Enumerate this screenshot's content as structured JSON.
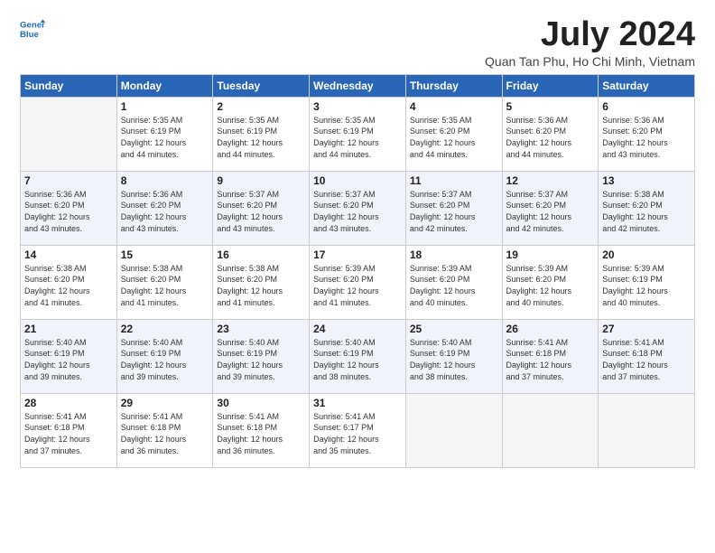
{
  "logo": {
    "line1": "General",
    "line2": "Blue"
  },
  "title": "July 2024",
  "subtitle": "Quan Tan Phu, Ho Chi Minh, Vietnam",
  "weekdays": [
    "Sunday",
    "Monday",
    "Tuesday",
    "Wednesday",
    "Thursday",
    "Friday",
    "Saturday"
  ],
  "weeks": [
    [
      {
        "day": "",
        "info": ""
      },
      {
        "day": "1",
        "info": "Sunrise: 5:35 AM\nSunset: 6:19 PM\nDaylight: 12 hours\nand 44 minutes."
      },
      {
        "day": "2",
        "info": "Sunrise: 5:35 AM\nSunset: 6:19 PM\nDaylight: 12 hours\nand 44 minutes."
      },
      {
        "day": "3",
        "info": "Sunrise: 5:35 AM\nSunset: 6:19 PM\nDaylight: 12 hours\nand 44 minutes."
      },
      {
        "day": "4",
        "info": "Sunrise: 5:35 AM\nSunset: 6:20 PM\nDaylight: 12 hours\nand 44 minutes."
      },
      {
        "day": "5",
        "info": "Sunrise: 5:36 AM\nSunset: 6:20 PM\nDaylight: 12 hours\nand 44 minutes."
      },
      {
        "day": "6",
        "info": "Sunrise: 5:36 AM\nSunset: 6:20 PM\nDaylight: 12 hours\nand 43 minutes."
      }
    ],
    [
      {
        "day": "7",
        "info": "Sunrise: 5:36 AM\nSunset: 6:20 PM\nDaylight: 12 hours\nand 43 minutes."
      },
      {
        "day": "8",
        "info": "Sunrise: 5:36 AM\nSunset: 6:20 PM\nDaylight: 12 hours\nand 43 minutes."
      },
      {
        "day": "9",
        "info": "Sunrise: 5:37 AM\nSunset: 6:20 PM\nDaylight: 12 hours\nand 43 minutes."
      },
      {
        "day": "10",
        "info": "Sunrise: 5:37 AM\nSunset: 6:20 PM\nDaylight: 12 hours\nand 43 minutes."
      },
      {
        "day": "11",
        "info": "Sunrise: 5:37 AM\nSunset: 6:20 PM\nDaylight: 12 hours\nand 42 minutes."
      },
      {
        "day": "12",
        "info": "Sunrise: 5:37 AM\nSunset: 6:20 PM\nDaylight: 12 hours\nand 42 minutes."
      },
      {
        "day": "13",
        "info": "Sunrise: 5:38 AM\nSunset: 6:20 PM\nDaylight: 12 hours\nand 42 minutes."
      }
    ],
    [
      {
        "day": "14",
        "info": "Sunrise: 5:38 AM\nSunset: 6:20 PM\nDaylight: 12 hours\nand 41 minutes."
      },
      {
        "day": "15",
        "info": "Sunrise: 5:38 AM\nSunset: 6:20 PM\nDaylight: 12 hours\nand 41 minutes."
      },
      {
        "day": "16",
        "info": "Sunrise: 5:38 AM\nSunset: 6:20 PM\nDaylight: 12 hours\nand 41 minutes."
      },
      {
        "day": "17",
        "info": "Sunrise: 5:39 AM\nSunset: 6:20 PM\nDaylight: 12 hours\nand 41 minutes."
      },
      {
        "day": "18",
        "info": "Sunrise: 5:39 AM\nSunset: 6:20 PM\nDaylight: 12 hours\nand 40 minutes."
      },
      {
        "day": "19",
        "info": "Sunrise: 5:39 AM\nSunset: 6:20 PM\nDaylight: 12 hours\nand 40 minutes."
      },
      {
        "day": "20",
        "info": "Sunrise: 5:39 AM\nSunset: 6:19 PM\nDaylight: 12 hours\nand 40 minutes."
      }
    ],
    [
      {
        "day": "21",
        "info": "Sunrise: 5:40 AM\nSunset: 6:19 PM\nDaylight: 12 hours\nand 39 minutes."
      },
      {
        "day": "22",
        "info": "Sunrise: 5:40 AM\nSunset: 6:19 PM\nDaylight: 12 hours\nand 39 minutes."
      },
      {
        "day": "23",
        "info": "Sunrise: 5:40 AM\nSunset: 6:19 PM\nDaylight: 12 hours\nand 39 minutes."
      },
      {
        "day": "24",
        "info": "Sunrise: 5:40 AM\nSunset: 6:19 PM\nDaylight: 12 hours\nand 38 minutes."
      },
      {
        "day": "25",
        "info": "Sunrise: 5:40 AM\nSunset: 6:19 PM\nDaylight: 12 hours\nand 38 minutes."
      },
      {
        "day": "26",
        "info": "Sunrise: 5:41 AM\nSunset: 6:18 PM\nDaylight: 12 hours\nand 37 minutes."
      },
      {
        "day": "27",
        "info": "Sunrise: 5:41 AM\nSunset: 6:18 PM\nDaylight: 12 hours\nand 37 minutes."
      }
    ],
    [
      {
        "day": "28",
        "info": "Sunrise: 5:41 AM\nSunset: 6:18 PM\nDaylight: 12 hours\nand 37 minutes."
      },
      {
        "day": "29",
        "info": "Sunrise: 5:41 AM\nSunset: 6:18 PM\nDaylight: 12 hours\nand 36 minutes."
      },
      {
        "day": "30",
        "info": "Sunrise: 5:41 AM\nSunset: 6:18 PM\nDaylight: 12 hours\nand 36 minutes."
      },
      {
        "day": "31",
        "info": "Sunrise: 5:41 AM\nSunset: 6:17 PM\nDaylight: 12 hours\nand 35 minutes."
      },
      {
        "day": "",
        "info": ""
      },
      {
        "day": "",
        "info": ""
      },
      {
        "day": "",
        "info": ""
      }
    ]
  ]
}
